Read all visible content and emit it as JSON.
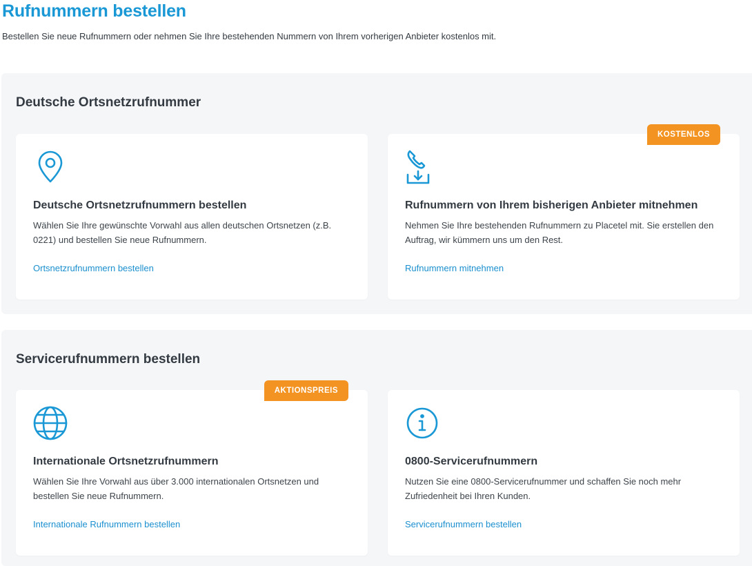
{
  "header": {
    "title": "Rufnummern bestellen",
    "subtitle": "Bestellen Sie neue Rufnummern oder nehmen Sie Ihre bestehenden Nummern von Ihrem vorherigen Anbieter kostenlos mit."
  },
  "colors": {
    "accent": "#1a98d5",
    "badge": "#f39322",
    "section_bg": "#f5f6f8"
  },
  "sections": [
    {
      "title": "Deutsche Ortsnetzrufnummer",
      "cards": [
        {
          "icon": "location-pin-icon",
          "title": "Deutsche Ortsnetzrufnummern bestellen",
          "text": "Wählen Sie Ihre gewünschte Vorwahl aus allen deutschen Ortsnetzen (z.B. 0221) und bestellen Sie neue Rufnummern.",
          "link": "Ortsnetzrufnummern bestellen"
        },
        {
          "icon": "phone-download-icon",
          "badge": "KOSTENLOS",
          "title": "Rufnummern von Ihrem bisherigen Anbieter mitnehmen",
          "text": "Nehmen Sie Ihre bestehenden Rufnummern zu Placetel mit. Sie erstellen den Auftrag, wir kümmern uns um den Rest.",
          "link": "Rufnummern mitnehmen"
        }
      ]
    },
    {
      "title": "Servicerufnummern bestellen",
      "cards": [
        {
          "icon": "globe-icon",
          "badge": "AKTIONSPREIS",
          "title": "Internationale Ortsnetzrufnummern",
          "text": "Wählen Sie Ihre Vorwahl aus über 3.000 internationalen Ortsnetzen und bestellen Sie neue Rufnummern.",
          "link": "Internationale Rufnummern bestellen"
        },
        {
          "icon": "info-icon",
          "title": "0800-Servicerufnummern",
          "text": "Nutzen Sie eine 0800-Servicerufnummer und schaffen Sie noch mehr Zufriedenheit bei Ihren Kunden.",
          "link": "Servicerufnummern bestellen"
        }
      ]
    }
  ]
}
